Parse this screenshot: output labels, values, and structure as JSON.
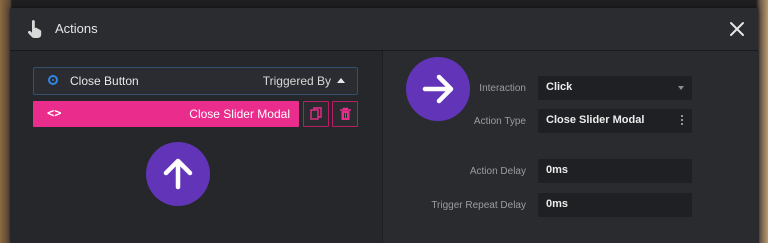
{
  "window": {
    "title": "Actions"
  },
  "trigger": {
    "name": "Close Button",
    "triggered_by_label": "Triggered By"
  },
  "action": {
    "label": "Close Slider Modal",
    "code_symbol": "<>"
  },
  "settings": {
    "interaction_label": "Interaction",
    "interaction_value": "Click",
    "action_type_label": "Action Type",
    "action_type_value": "Close Slider Modal",
    "action_delay_label": "Action Delay",
    "action_delay_value": "0ms",
    "trigger_repeat_delay_label": "Trigger Repeat Delay",
    "trigger_repeat_delay_value": "0ms"
  },
  "icons": {
    "title_icon": "hand-pointer-icon",
    "close_icon": "close-icon",
    "copy_icon": "copy-icon",
    "delete_icon": "trash-icon",
    "arrow_up": "arrow-up-icon",
    "arrow_right": "arrow-right-icon"
  },
  "colors": {
    "accent_pink": "#ea2d8c",
    "accent_purple": "#6235b8",
    "accent_blue": "#2f86e6"
  }
}
